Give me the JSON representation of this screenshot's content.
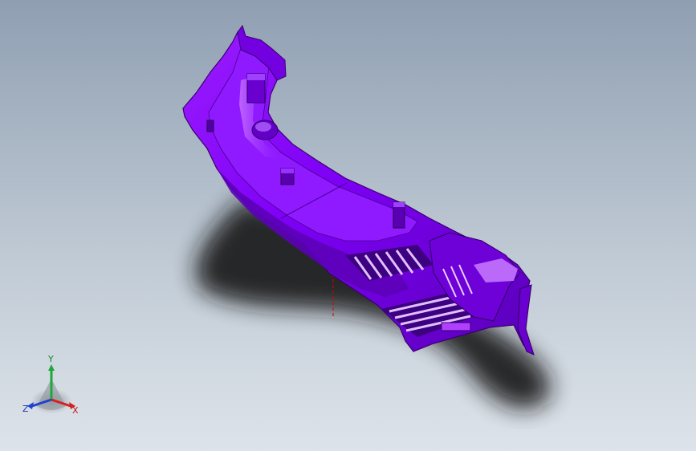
{
  "viewport": {
    "background_top": "#8f9fb2",
    "background_bottom": "#dde3ea",
    "part_color": "#8000ff",
    "part_shadow_color": "#4a0099",
    "part_highlight_color": "#c070ff",
    "shadow_color": "#1a1a1a",
    "centerline_color": "#d60000"
  },
  "triad": {
    "y_label": "Y",
    "x_label": "X",
    "z_label": "Z",
    "y_color": "#1fa83a",
    "x_color": "#d62020",
    "z_color": "#2040d0"
  }
}
